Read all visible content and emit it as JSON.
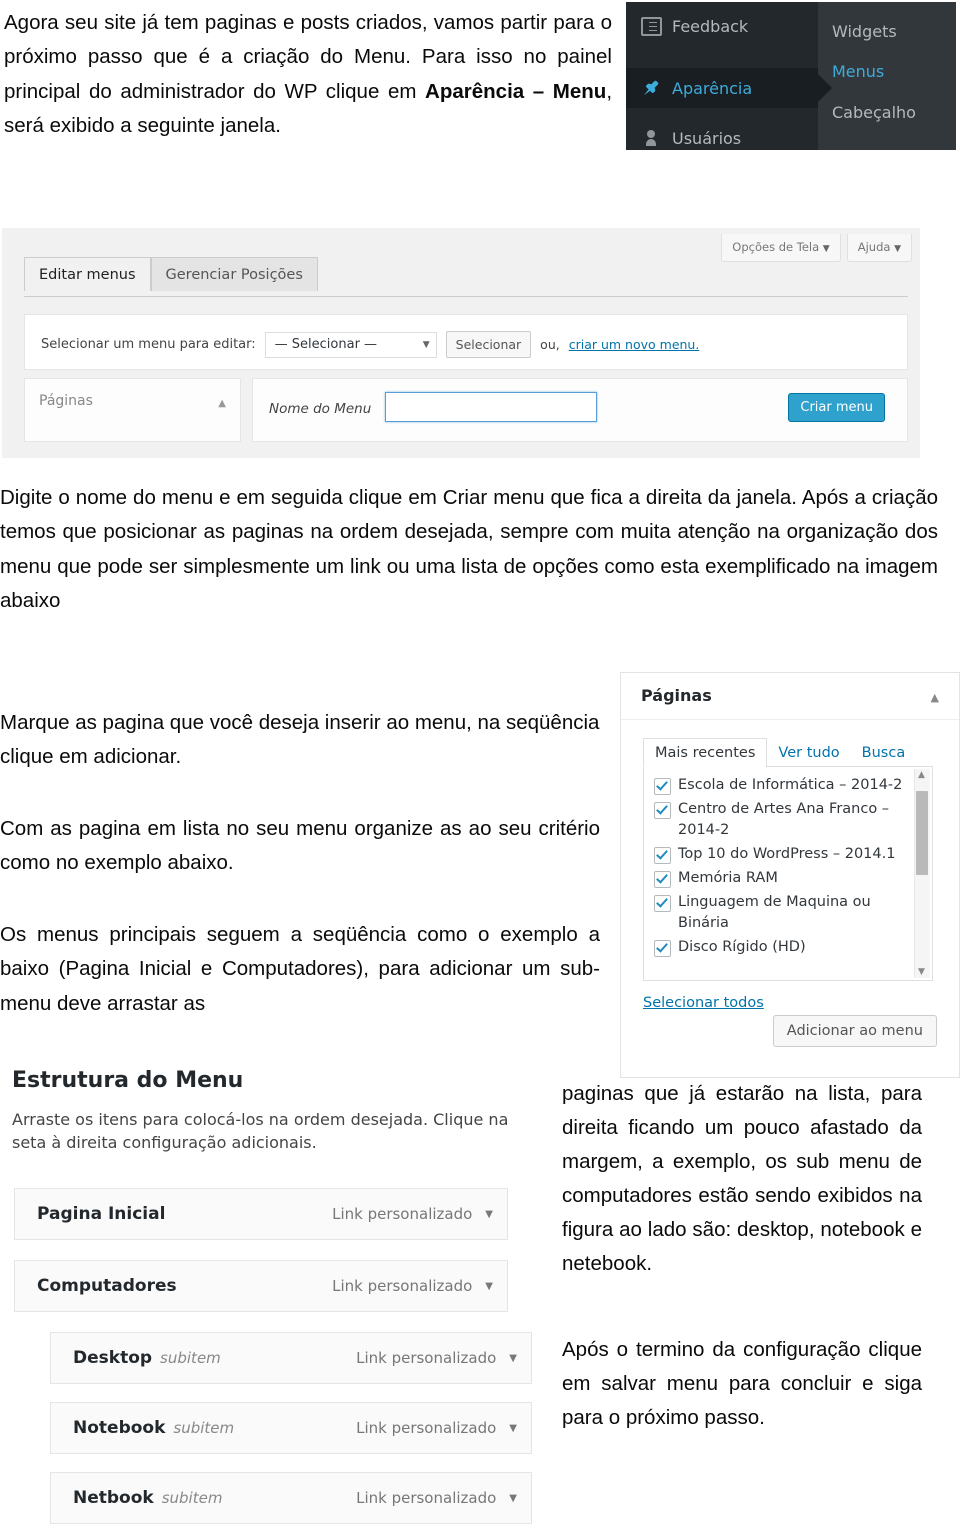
{
  "document": {
    "paragraphs": {
      "intro_part1": "Agora seu site já tem paginas e posts criados, vamos partir para o próximo passo que é a criação do Menu. Para isso no painel principal do administrador do WP clique em ",
      "intro_bold": "Aparência – Menu",
      "intro_part2": ", será exibido a seguinte janela.",
      "digite": "Digite o nome do menu e em seguida clique em Criar menu que fica a direita da janela. Após a criação temos que posicionar as paginas na ordem desejada, sempre com muita atenção na organização dos menu que pode ser simplesmente um link ou uma lista de opções como esta exemplificado na imagem abaixo",
      "marque": "Marque as pagina que você deseja inserir ao menu, na seqüência clique em adicionar.",
      "com_as_pagina": "Com as pagina em lista no seu menu organize as ao seu critério como no exemplo abaixo.",
      "os_menus": "Os menus principais seguem a seqüência como o exemplo a baixo (Pagina Inicial e Computadores), para adicionar um sub-menu deve arrastar as",
      "right_continuation": "paginas que já estarão na lista, para direita ficando um pouco afastado da margem, a exemplo, os sub menu de computadores estão sendo exibidos na figura ao lado são: desktop, notebook e netebook.",
      "right_final": "Após o termino da configuração clique em salvar menu para concluir e siga para o próximo passo."
    }
  },
  "wp_sidebar": {
    "items": [
      {
        "label": "Feedback",
        "icon": "feedback-icon",
        "active": false
      },
      {
        "label": "Aparência",
        "icon": "appearance-pin-icon",
        "active": true
      },
      {
        "label": "Usuários",
        "icon": "users-icon",
        "active": false
      }
    ],
    "submenu": [
      {
        "label": "Widgets",
        "selected": false
      },
      {
        "label": "Menus",
        "selected": true
      },
      {
        "label": "Cabeçalho",
        "selected": false
      }
    ],
    "colors": {
      "sidebar_bg": "#23282d",
      "submenu_bg": "#32373c",
      "active_bg": "#191e23",
      "accent": "#3eacdb"
    }
  },
  "menu_editor": {
    "screen_options_label": "Opções de Tela",
    "help_label": "Ajuda",
    "tabs": [
      {
        "label": "Editar menus",
        "active": true
      },
      {
        "label": "Gerenciar Posições",
        "active": false
      }
    ],
    "select_menu_label": "Selecionar um menu para editar:",
    "select_value": "— Selecionar —",
    "select_button": "Selecionar",
    "or_text": "ou,",
    "create_new_link": "criar um novo menu.",
    "paginas_box_title": "Páginas",
    "menu_name_label": "Nome do Menu",
    "menu_name_value": "",
    "create_menu_button": "Criar menu",
    "create_menu_color": "#2ea2cc"
  },
  "paginas_box": {
    "title": "Páginas",
    "tabs": [
      {
        "label": "Mais recentes",
        "active": true
      },
      {
        "label": "Ver tudo",
        "active": false
      },
      {
        "label": "Busca",
        "active": false
      }
    ],
    "items": [
      {
        "label": "Escola de Informática – 2014-2",
        "checked": true
      },
      {
        "label": "Centro de Artes Ana Franco – 2014-2",
        "checked": true
      },
      {
        "label": "Top 10 do WordPress – 2014.1",
        "checked": true
      },
      {
        "label": "Memória RAM",
        "checked": true
      },
      {
        "label": "Linguagem de Maquina ou Binária",
        "checked": true
      },
      {
        "label": "Disco Rígido (HD)",
        "checked": true
      }
    ],
    "select_all_label": "Selecionar todos",
    "add_to_menu_label": "Adicionar ao menu"
  },
  "menu_structure": {
    "title": "Estrutura do Menu",
    "description": "Arraste os itens para colocá-los na ordem desejada. Clique na seta à direita configuração adicionais.",
    "subitem_tag": "subitem",
    "items": [
      {
        "name": "Pagina Inicial",
        "type": "Link personalizado",
        "is_sub": false
      },
      {
        "name": "Computadores",
        "type": "Link personalizado",
        "is_sub": false
      },
      {
        "name": "Desktop",
        "type": "Link personalizado",
        "is_sub": true
      },
      {
        "name": "Notebook",
        "type": "Link personalizado",
        "is_sub": true
      },
      {
        "name": "Netbook",
        "type": "Link personalizado",
        "is_sub": true
      }
    ]
  }
}
